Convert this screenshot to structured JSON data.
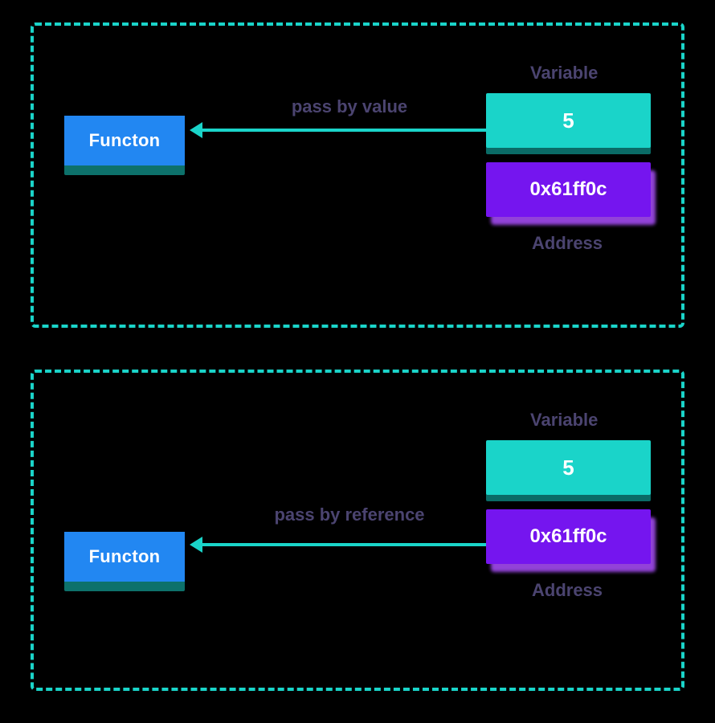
{
  "panel1": {
    "function_label": "Functon",
    "variable_label": "Variable",
    "value": "5",
    "address": "0x61ff0c",
    "address_label": "Address",
    "arrow_caption": "pass by value"
  },
  "panel2": {
    "function_label": "Functon",
    "variable_label": "Variable",
    "value": "5",
    "address": "0x61ff0c",
    "address_label": "Address",
    "arrow_caption": "pass by reference"
  }
}
